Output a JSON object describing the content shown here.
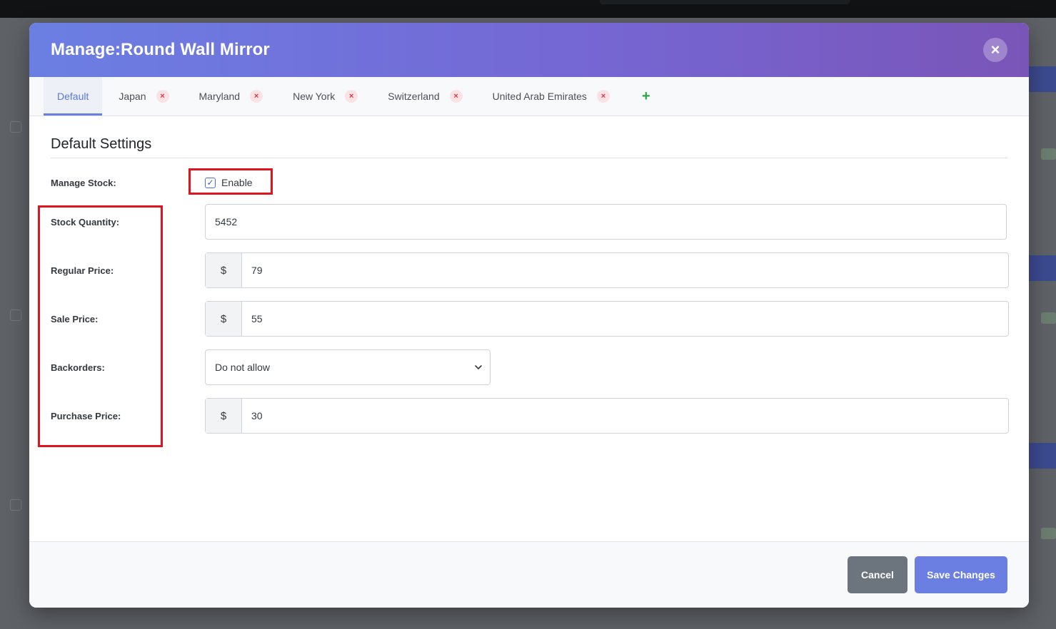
{
  "modal": {
    "title": "Manage:Round Wall Mirror",
    "close_icon": "×"
  },
  "tabs": [
    {
      "label": "Default",
      "active": true,
      "removable": false
    },
    {
      "label": "Japan",
      "active": false,
      "removable": true
    },
    {
      "label": "Maryland",
      "active": false,
      "removable": true
    },
    {
      "label": "New York",
      "active": false,
      "removable": true
    },
    {
      "label": "Switzerland",
      "active": false,
      "removable": true
    },
    {
      "label": "United Arab Emirates",
      "active": false,
      "removable": true
    }
  ],
  "tab_remove_glyph": "×",
  "tab_add_glyph": "+",
  "section": {
    "title": "Default Settings"
  },
  "form": {
    "manage_stock": {
      "label": "Manage Stock:",
      "checkbox_label": "Enable",
      "checked": true
    },
    "stock_quantity": {
      "label": "Stock Quantity:",
      "value": "5452"
    },
    "regular_price": {
      "label": "Regular Price:",
      "currency": "$",
      "value": "79"
    },
    "sale_price": {
      "label": "Sale Price:",
      "currency": "$",
      "value": "55"
    },
    "backorders": {
      "label": "Backorders:",
      "value": "Do not allow"
    },
    "purchase_price": {
      "label": "Purchase Price:",
      "currency": "$",
      "value": "30"
    }
  },
  "footer": {
    "cancel_label": "Cancel",
    "save_label": "Save Changes"
  },
  "colors": {
    "header_gradient_start": "#6b7fe3",
    "header_gradient_end": "#7a55b8",
    "accent": "#6b7fe3",
    "remove": "#dc3545",
    "add": "#28a745",
    "highlight": "#e0141e"
  }
}
